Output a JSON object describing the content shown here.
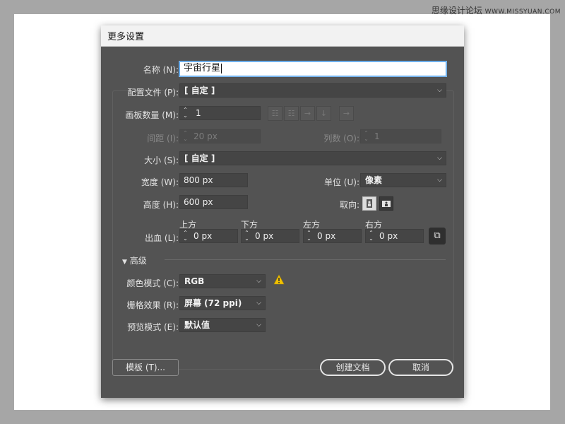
{
  "watermark": {
    "text": "思缘设计论坛",
    "sub": "WWW.MISSYUAN.COM"
  },
  "dialog": {
    "title": "更多设置",
    "name": {
      "label": "名称 (N):",
      "value": "宇宙行星"
    },
    "profile": {
      "label": "配置文件 (P):",
      "value": "[ 自定 ]"
    },
    "artboards": {
      "label": "画板数量 (M):",
      "value": "1"
    },
    "spacing": {
      "label": "间距 (I):",
      "value": "20 px"
    },
    "columns": {
      "label": "列数 (O):",
      "value": "1"
    },
    "size": {
      "label": "大小 (S):",
      "value": "[ 自定 ]"
    },
    "width": {
      "label": "宽度 (W):",
      "value": "800 px"
    },
    "units": {
      "label": "单位 (U):",
      "value": "像素"
    },
    "height": {
      "label": "高度 (H):",
      "value": "600 px"
    },
    "orientation": {
      "label": "取向:",
      "selected": "landscape"
    },
    "bleed": {
      "label": "出血 (L):",
      "top": {
        "label": "上方",
        "value": "0 px"
      },
      "bottom": {
        "label": "下方",
        "value": "0 px"
      },
      "left": {
        "label": "左方",
        "value": "0 px"
      },
      "right": {
        "label": "右方",
        "value": "0 px"
      }
    },
    "advanced": {
      "label": "高级"
    },
    "color_mode": {
      "label": "颜色模式 (C):",
      "value": "RGB"
    },
    "raster": {
      "label": "栅格效果 (R):",
      "value": "屏幕 (72 ppi)"
    },
    "preview": {
      "label": "预览模式 (E):",
      "value": "默认值"
    },
    "buttons": {
      "templates": "模板 (T)...",
      "create": "创建文档",
      "cancel": "取消"
    },
    "colors": {
      "panel": "#535353",
      "warning": "#f2c200",
      "titlebar": "#f2f2f2"
    }
  }
}
